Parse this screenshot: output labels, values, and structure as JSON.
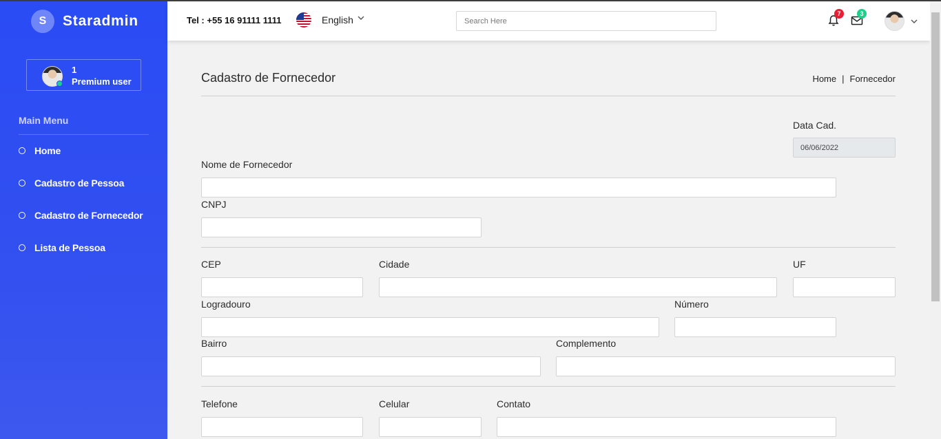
{
  "brand": {
    "logo_letter": "S",
    "name": "Staradmin"
  },
  "user": {
    "name": "1",
    "role": "Premium user"
  },
  "sidebar": {
    "menu_title": "Main Menu",
    "items": [
      {
        "label": "Home"
      },
      {
        "label": "Cadastro de Pessoa"
      },
      {
        "label": "Cadastro de Fornecedor"
      },
      {
        "label": "Lista de Pessoa"
      }
    ]
  },
  "header": {
    "tel": "Tel : +55 16 91111 1111",
    "language": "English",
    "search_placeholder": "Search Here",
    "notifications_count": "7",
    "messages_count": "3"
  },
  "page": {
    "title": "Cadastro de Fornecedor",
    "breadcrumb": [
      "Home",
      "Fornecedor"
    ],
    "breadcrumb_sep": "|"
  },
  "form": {
    "data_cad": {
      "label": "Data Cad.",
      "value": "06/06/2022"
    },
    "nome": {
      "label": "Nome de Fornecedor",
      "value": ""
    },
    "cnpj": {
      "label": "CNPJ",
      "value": ""
    },
    "cep": {
      "label": "CEP",
      "value": ""
    },
    "cidade": {
      "label": "Cidade",
      "value": ""
    },
    "uf": {
      "label": "UF",
      "value": ""
    },
    "logradouro": {
      "label": "Logradouro",
      "value": ""
    },
    "numero": {
      "label": "Número",
      "value": ""
    },
    "bairro": {
      "label": "Bairro",
      "value": ""
    },
    "complemento": {
      "label": "Complemento",
      "value": ""
    },
    "telefone": {
      "label": "Telefone",
      "value": ""
    },
    "celular": {
      "label": "Celular",
      "value": ""
    },
    "contato": {
      "label": "Contato",
      "value": ""
    }
  },
  "colors": {
    "sidebar": "#2a4cf5",
    "badge_red": "#e81e35",
    "badge_green": "#1bd08a"
  }
}
